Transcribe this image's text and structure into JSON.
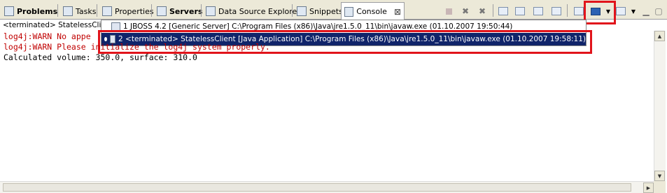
{
  "tabs": [
    {
      "label": "Problems",
      "icon": "problems-icon",
      "bold": true
    },
    {
      "label": "Tasks",
      "icon": "tasks-icon"
    },
    {
      "label": "Properties",
      "icon": "properties-icon"
    },
    {
      "label": "Servers",
      "icon": "servers-icon",
      "bold": true
    },
    {
      "label": "Data Source Explorer",
      "icon": "data-source-icon"
    },
    {
      "label": "Snippets",
      "icon": "snippets-icon"
    },
    {
      "label": "Console",
      "icon": "console-icon",
      "active": true
    }
  ],
  "console_header": "<terminated> StatelessClient",
  "launch_menu": {
    "items": [
      {
        "label": "1 JBOSS 4.2 [Generic Server] C:\\Program Files (x86)\\Java\\jre1.5.0_11\\bin\\javaw.exe (01.10.2007 19:50:44)"
      },
      {
        "label": "2 <terminated> StatelessClient [Java Application] C:\\Program Files (x86)\\Java\\jre1.5.0_11\\bin\\javaw.exe (01.10.2007 19:58:11)",
        "selected": true
      }
    ]
  },
  "console_lines": [
    {
      "text": "log4j:WARN No appe",
      "type": "warn"
    },
    {
      "text": "log4j:WARN Please initialize the log4j system properly.",
      "type": "warn"
    },
    {
      "text": "Calculated volume: 350.0, surface: 310.0",
      "type": "normal"
    }
  ],
  "colors": {
    "warn": "#c00000",
    "highlight": "#e1141b",
    "selection": "#10246a"
  }
}
